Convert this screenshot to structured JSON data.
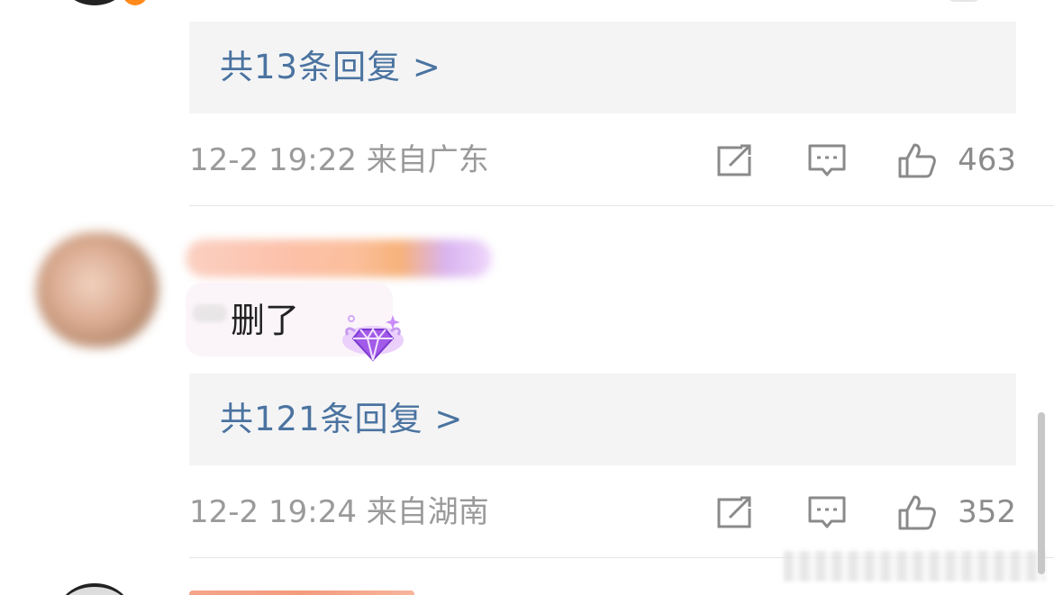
{
  "comments": [
    {
      "reply_summary": "共13条回复 >",
      "time_location": "12-2 19:22  来自广东",
      "likes": "463"
    },
    {
      "text": "删了",
      "reply_summary": "共121条回复 >",
      "time_location": "12-2 19:24  来自湖南",
      "likes": "352"
    }
  ],
  "icons": {
    "share": "share-icon",
    "comment": "comment-icon",
    "like": "thumbs-up-icon"
  },
  "colors": {
    "reply_link": "#4a73a0",
    "meta_text": "#9a9a9a",
    "reply_bg": "#f4f4f5"
  }
}
